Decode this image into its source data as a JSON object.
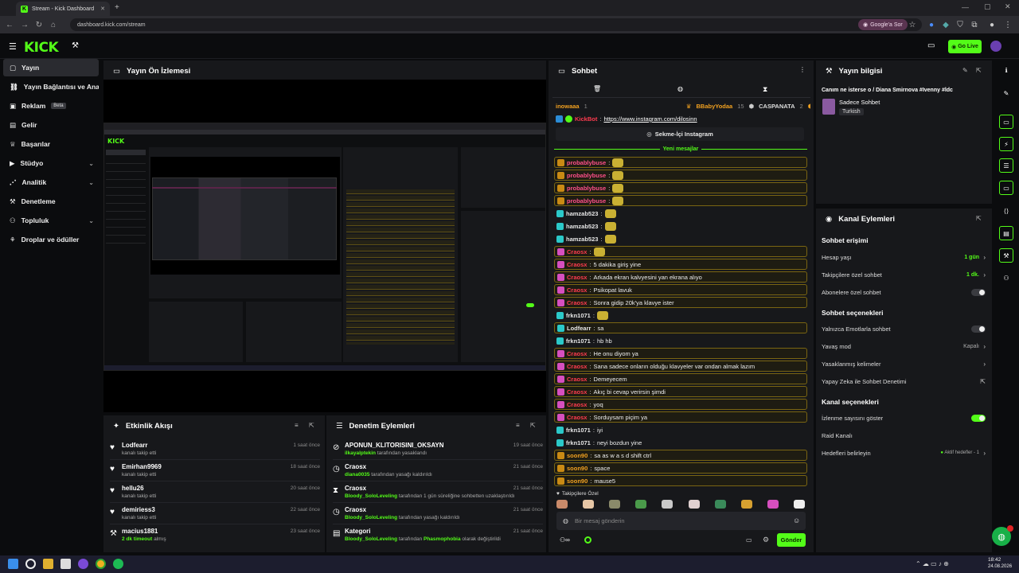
{
  "browser": {
    "tab_title": "Stream - Kick Dashboard",
    "url": "dashboard.kick.com/stream",
    "google_sor": "Google'a Sor"
  },
  "app": {
    "logo": "KICK",
    "go_live": "Go Live"
  },
  "sidebar": {
    "items": [
      {
        "label": "Yayın",
        "icon": "broadcast-icon"
      },
      {
        "label": "Yayın Bağlantısı ve Anahtar",
        "icon": "link-icon"
      },
      {
        "label": "Reklam",
        "icon": "ad-icon",
        "badge": "Beta"
      },
      {
        "label": "Gelir",
        "icon": "money-icon"
      },
      {
        "label": "Başarılar",
        "icon": "trophy-icon"
      },
      {
        "label": "Stüdyo",
        "icon": "video-icon"
      },
      {
        "label": "Analitik",
        "icon": "chart-icon"
      },
      {
        "label": "Denetleme",
        "icon": "hammer-icon"
      },
      {
        "label": "Topluluk",
        "icon": "people-icon"
      },
      {
        "label": "Droplar ve ödüller",
        "icon": "gift-icon"
      }
    ]
  },
  "preview": {
    "title": "Yayın Ön İzlemesi"
  },
  "activity": {
    "title": "Etkinlik Akışı",
    "rows": [
      {
        "name": "Lodfearr",
        "sub": "kanalı takip etti",
        "time": "1 saat önce"
      },
      {
        "name": "Emirhan9969",
        "sub": "kanalı takip etti",
        "time": "18 saat önce"
      },
      {
        "name": "hellu26",
        "sub": "kanalı takip etti",
        "time": "20 saat önce"
      },
      {
        "name": "demiriess3",
        "sub": "kanalı takip etti",
        "time": "22 saat önce"
      },
      {
        "name": "macius1881",
        "sub_green": "2 dk timeout",
        "sub": "almış",
        "time": "23 saat önce"
      }
    ]
  },
  "moderation": {
    "title": "Denetim Eylemleri",
    "rows": [
      {
        "name": "APONUN_KLITORISINI_OKSAYN",
        "actor": "ilkayalptekin",
        "text": "tarafından yasaklandı",
        "time": "19 saat önce"
      },
      {
        "name": "Craosx",
        "actor": "diana0035",
        "text": "tarafından yasağı kaldırıldı",
        "time": "21 saat önce"
      },
      {
        "name": "Craosx",
        "actor": "Bloody_SoloLeveling",
        "text": "tarafından 1 gün süreliğine sohbetten uzaklaştırıldı",
        "time": "21 saat önce"
      },
      {
        "name": "Craosx",
        "actor": "Bloody_SoloLeveling",
        "text": "tarafından yasağı kaldırıldı",
        "time": "21 saat önce"
      },
      {
        "name": "Kategori",
        "actor": "Bloody_SoloLeveling",
        "text_pre": "tarafından",
        "actor2": "Phasmophobia",
        "text": "olarak değiştirildi",
        "time": "21 saat önce"
      }
    ]
  },
  "chat": {
    "title": "Sohbet",
    "leaderboard": [
      {
        "name": "inowaaa",
        "count": "1"
      },
      {
        "name": "BBabyYodaa",
        "count": "15"
      },
      {
        "name": "CASPANATA",
        "count": "2"
      },
      {
        "name": "K",
        "count": ""
      }
    ],
    "bot_name": "KickBot",
    "bot_link": "https://www.instagram.com/dilosinn",
    "instagram_button": "Sekme-İçi Instagram",
    "new_messages": "Yeni mesajlar",
    "messages": [
      {
        "user": "probablybuse",
        "text": "",
        "color": "#ff4f8a",
        "badge": "#c98a14",
        "emote": true,
        "hl": true
      },
      {
        "user": "probablybuse",
        "text": "",
        "color": "#ff4f8a",
        "badge": "#c98a14",
        "emote": true,
        "hl": true
      },
      {
        "user": "probablybuse",
        "text": "",
        "color": "#ff4f8a",
        "badge": "#c98a14",
        "emote": true,
        "hl": true
      },
      {
        "user": "probablybuse",
        "text": "",
        "color": "#ff4f8a",
        "badge": "#c98a14",
        "emote": true,
        "hl": true
      },
      {
        "user": "hamzab523",
        "text": "",
        "color": "#e6e6e6",
        "badge": "#2bc9c9",
        "emote": true,
        "hl": false
      },
      {
        "user": "hamzab523",
        "text": "",
        "color": "#e6e6e6",
        "badge": "#2bc9c9",
        "emote": true,
        "hl": false
      },
      {
        "user": "hamzab523",
        "text": "",
        "color": "#e6e6e6",
        "badge": "#2bc9c9",
        "emote": true,
        "hl": false
      },
      {
        "user": "Craosx",
        "text": "",
        "color": "#ff3b4f",
        "badge": "#d64fbf",
        "emote": true,
        "hl": true
      },
      {
        "user": "Craosx",
        "text": "5 dakika giriş yine",
        "color": "#ff3b4f",
        "badge": "#d64fbf",
        "emote": false,
        "hl": true
      },
      {
        "user": "Craosx",
        "text": "Arkada ekran kalvyesini yan ekrana alıyo",
        "color": "#ff3b4f",
        "badge": "#d64fbf",
        "emote": false,
        "hl": true
      },
      {
        "user": "Craosx",
        "text": "Psikopat lavuk",
        "color": "#ff3b4f",
        "badge": "#d64fbf",
        "emote": false,
        "hl": true
      },
      {
        "user": "Craosx",
        "text": "Sonra gidip 20k'ya klavye ister",
        "color": "#ff3b4f",
        "badge": "#d64fbf",
        "emote": false,
        "hl": true
      },
      {
        "user": "frkn1071",
        "text": "",
        "color": "#e6e6e6",
        "badge": "#2bc9c9",
        "emote": true,
        "hl": false
      },
      {
        "user": "Lodfearr",
        "text": "sa",
        "color": "#e6e6e6",
        "badge": "#2bc9c9",
        "emote": false,
        "hl": true
      },
      {
        "user": "frkn1071",
        "text": "hb hb",
        "color": "#e6e6e6",
        "badge": "#2bc9c9",
        "emote": false,
        "hl": false
      },
      {
        "user": "Craosx",
        "text": "He onu diyom ya",
        "color": "#ff3b4f",
        "badge": "#d64fbf",
        "emote": false,
        "hl": true
      },
      {
        "user": "Craosx",
        "text": "Sana sadece onların olduğu klavyeler var ondan almak lazım",
        "color": "#ff3b4f",
        "badge": "#d64fbf",
        "emote": false,
        "hl": true
      },
      {
        "user": "Craosx",
        "text": "Demeyecem",
        "color": "#ff3b4f",
        "badge": "#d64fbf",
        "emote": false,
        "hl": true
      },
      {
        "user": "Craosx",
        "text": "Akıç bi cevap verirsin şimdi",
        "color": "#ff3b4f",
        "badge": "#d64fbf",
        "emote": false,
        "hl": true
      },
      {
        "user": "Craosx",
        "text": "yoq",
        "color": "#ff3b4f",
        "badge": "#d64fbf",
        "emote": false,
        "hl": true
      },
      {
        "user": "Craosx",
        "text": "Sorduysam piçim ya",
        "color": "#ff3b4f",
        "badge": "#d64fbf",
        "emote": false,
        "hl": true
      },
      {
        "user": "frkn1071",
        "text": "iyi",
        "color": "#e6e6e6",
        "badge": "#2bc9c9",
        "emote": false,
        "hl": false
      },
      {
        "user": "frkn1071",
        "text": "neyi bozdun yine",
        "color": "#e6e6e6",
        "badge": "#2bc9c9",
        "emote": false,
        "hl": false
      },
      {
        "user": "soon90",
        "text": "sa as w a s d shift ctrl",
        "color": "#f0a020",
        "badge": "#c98a14",
        "emote": false,
        "hl": true
      },
      {
        "user": "soon90",
        "text": "space",
        "color": "#f0a020",
        "badge": "#c98a14",
        "emote": false,
        "hl": true
      },
      {
        "user": "soon90",
        "text": "mause5",
        "color": "#f0a020",
        "badge": "#c98a14",
        "emote": false,
        "hl": true
      }
    ],
    "followers_only": "Takipçilere Özel",
    "input_placeholder": "Bir mesaj gönderin",
    "send": "Gönder"
  },
  "stream_info": {
    "title": "Yayın bilgisi",
    "stream_title": "Canım ne isterse o / Diana Smirnova #Ivenny #ldc",
    "category": "Sadece Sohbet",
    "language": "Turkish"
  },
  "channel_actions": {
    "title": "Kanal Eylemleri",
    "chat_access": "Sohbet erişimi",
    "account_age": "Hesap yaşı",
    "account_age_val": "1 gün",
    "followers_chat": "Takipçilere özel sohbet",
    "followers_chat_val": "1 dk.",
    "subscribers_chat": "Abonelere özel sohbet",
    "chat_options": "Sohbet seçenekleri",
    "emote_only": "Yalnızca Emotlarla sohbet",
    "slow_mode": "Yavaş mod",
    "slow_mode_val": "Kapalı",
    "banned_words": "Yasaklanmış kelimeler",
    "ai_moderation": "Yapay Zeka ile Sohbet Denetimi",
    "channel_options": "Kanal seçenekleri",
    "show_viewers": "İzlenme sayısını göster",
    "raid": "Raid Kanalı",
    "goals": "Hedefleri belirleyin",
    "goals_val": "Aktif hedefler - 1"
  },
  "taskbar": {
    "time": "18:42",
    "date": "24.08.2026"
  },
  "colors": {
    "brand": "#53fc18",
    "panel": "#17181b",
    "background": "#0b0c0e"
  }
}
